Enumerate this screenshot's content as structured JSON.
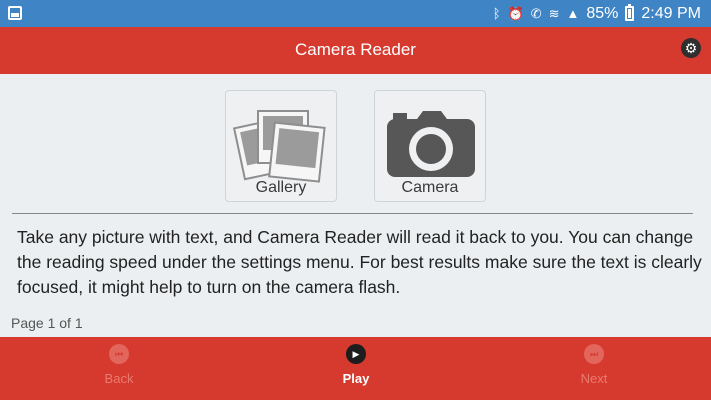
{
  "status_bar": {
    "battery": "85%",
    "time": "2:49 PM",
    "icons": [
      "image-icon",
      "bluetooth-icon",
      "alarm-icon",
      "wifi-call-icon",
      "wifi-icon",
      "signal-icon",
      "battery-icon"
    ]
  },
  "app_bar": {
    "title": "Camera Reader",
    "settings_icon": "gear-icon"
  },
  "sources": {
    "gallery_label": "Gallery",
    "camera_label": "Camera"
  },
  "description": "Take any picture with text, and Camera Reader will read it back to you. You can change the reading speed under the settings menu. For best results make sure the text is clearly focused, it might help to turn on the camera flash.",
  "page_indicator": "Page 1 of 1",
  "bottom_nav": {
    "back_label": "Back",
    "play_label": "Play",
    "next_label": "Next"
  },
  "colors": {
    "status_bar": "#3f84c4",
    "app_bar": "#d63a2f",
    "background": "#eceff1"
  }
}
